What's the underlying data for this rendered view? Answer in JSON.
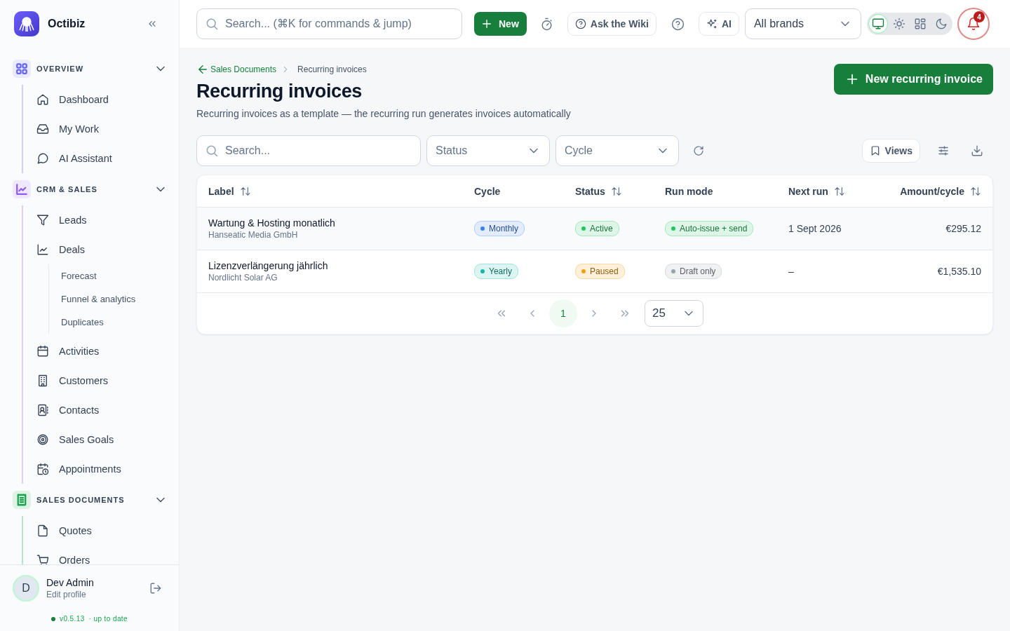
{
  "brand": {
    "name": "Octibiz"
  },
  "sidebar": {
    "sections": [
      {
        "label": "OVERVIEW",
        "color": "#6366f1",
        "expanded": true,
        "items": [
          {
            "label": "Dashboard"
          },
          {
            "label": "My Work"
          },
          {
            "label": "AI Assistant"
          }
        ]
      },
      {
        "label": "CRM & SALES",
        "color": "#8b5cf6",
        "expanded": true,
        "items": [
          {
            "label": "Leads"
          },
          {
            "label": "Deals",
            "children": [
              {
                "label": "Forecast"
              },
              {
                "label": "Funnel & analytics"
              },
              {
                "label": "Duplicates"
              }
            ]
          },
          {
            "label": "Activities"
          },
          {
            "label": "Customers"
          },
          {
            "label": "Contacts"
          },
          {
            "label": "Sales Goals"
          },
          {
            "label": "Appointments"
          }
        ]
      },
      {
        "label": "SALES DOCUMENTS",
        "color": "#16a34a",
        "expanded": true,
        "items": [
          {
            "label": "Quotes"
          },
          {
            "label": "Orders"
          }
        ]
      }
    ],
    "user": {
      "initial": "D",
      "name": "Dev Admin",
      "subtitle": "Edit profile"
    },
    "version": {
      "number": "v0.5.13",
      "status": "· up to date"
    }
  },
  "topbar": {
    "search": {
      "placeholder": "Search... (⌘K for commands & jump)"
    },
    "new_button": "New",
    "wiki_button": "Ask the Wiki",
    "ai_button": "AI",
    "brand_select": {
      "value": "All brands"
    },
    "theme_modes": [
      {
        "selected": true
      },
      {
        "selected": false
      },
      {
        "selected": false
      },
      {
        "selected": false
      }
    ],
    "notifications": {
      "count": "4"
    }
  },
  "page": {
    "breadcrumb": [
      {
        "label": "Sales Documents",
        "kind": "link"
      },
      {
        "label": "Recurring invoices",
        "kind": "current"
      }
    ],
    "title": "Recurring invoices",
    "subtitle": "Recurring invoices as a template — the recurring run generates invoices automatically",
    "primary_button": "New recurring invoice"
  },
  "filters": {
    "search": {
      "placeholder": "Search..."
    },
    "selects": [
      {
        "label": "Status"
      },
      {
        "label": "Cycle"
      }
    ],
    "views_button": "Views"
  },
  "table": {
    "columns": [
      {
        "label": "Label",
        "sortable": true
      },
      {
        "label": "Cycle",
        "sortable": false
      },
      {
        "label": "Status",
        "sortable": true
      },
      {
        "label": "Run mode",
        "sortable": false
      },
      {
        "label": "Next run",
        "sortable": true
      },
      {
        "label": "Amount/cycle",
        "sortable": true
      }
    ],
    "rows": [
      {
        "label": "Wartung & Hosting monatlich",
        "customer": "Hanseatic Media GmbH",
        "cycle": {
          "text": "Monthly",
          "color": "#3b82f6"
        },
        "status": {
          "text": "Active",
          "color": "#22c55e"
        },
        "run_mode": {
          "text": "Auto-issue + send",
          "color": "#22c55e"
        },
        "next_run": "1 Sept 2026",
        "amount": "€295.12"
      },
      {
        "label": "Lizenzverlängerung jährlich",
        "customer": "Nordlicht Solar AG",
        "cycle": {
          "text": "Yearly",
          "color": "#14b8a6"
        },
        "status": {
          "text": "Paused",
          "color": "#f59e0b"
        },
        "run_mode": {
          "text": "Draft only",
          "color": "#9ca3af"
        },
        "next_run": "–",
        "amount": "€1,535.10"
      }
    ]
  },
  "pagination": {
    "pages": [
      {
        "label": "1",
        "selected": true
      }
    ],
    "page_size": "25"
  }
}
